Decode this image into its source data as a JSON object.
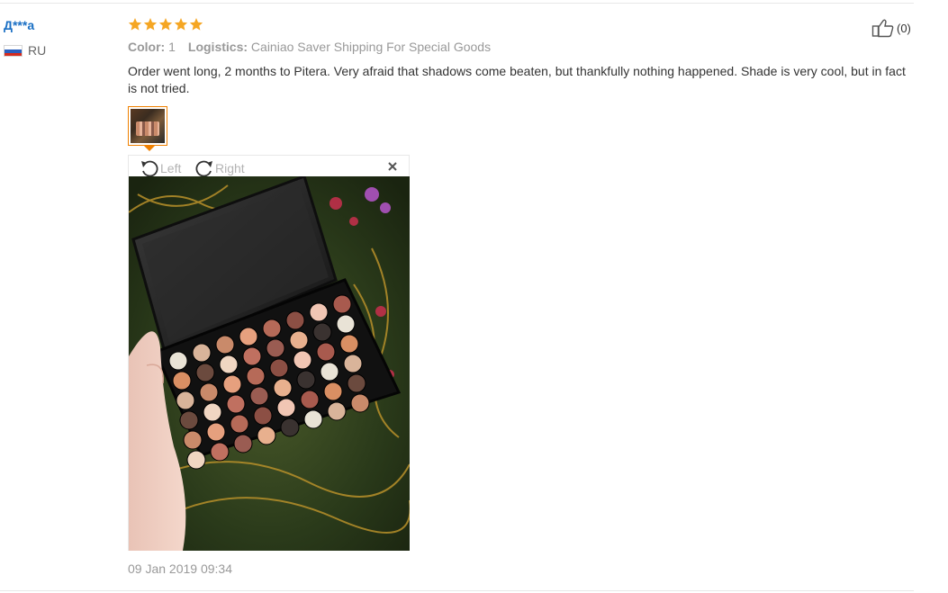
{
  "review": {
    "user_name": "Д***а",
    "country_code": "RU",
    "stars": 5,
    "color_label": "Color:",
    "color_value": "1",
    "logistics_label": "Logistics:",
    "logistics_value": "Cainiao Saver Shipping For Special Goods",
    "feedback": "Order went long, 2 months to Pitera. Very afraid that shadows come beaten, but thankfully nothing happened. Shade is very cool, but in fact is not tried.",
    "date": "09 Jan 2019 09:34",
    "helpful_count": "(0)"
  },
  "viewer": {
    "rotate_left_label": "Left",
    "rotate_right_label": "Right"
  },
  "colors": {
    "username": "#1a6fc4",
    "star": "#f5a623",
    "thumb_border": "#f08000",
    "muted_text": "#999999"
  },
  "icons": {
    "flag": "russia-flag-icon",
    "like": "thumbs-up-icon",
    "rotate_left": "rotate-left-icon",
    "rotate_right": "rotate-right-icon",
    "close": "close-icon"
  }
}
